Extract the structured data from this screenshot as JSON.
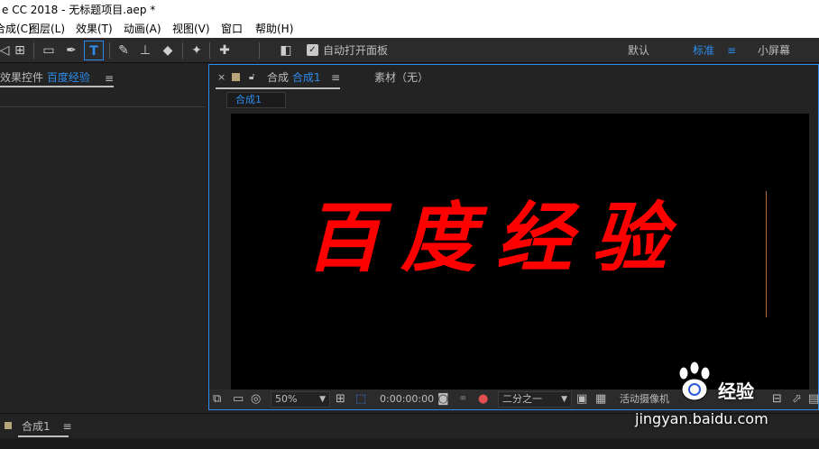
{
  "window": {
    "title": "e CC 2018 - 无标题项目.aep *"
  },
  "menu": [
    {
      "label": "合成(C)"
    },
    {
      "label": "图层(L)"
    },
    {
      "label": "效果(T)"
    },
    {
      "label": "动画(A)"
    },
    {
      "label": "视图(V)"
    },
    {
      "label": "窗口"
    },
    {
      "label": "帮助(H)"
    }
  ],
  "toolbar": {
    "auto_open_label": "自动打开面板",
    "auto_open_checked": true,
    "workspaces": [
      {
        "label": "默认",
        "active": false
      },
      {
        "label": "标准",
        "active": true
      },
      {
        "label": "小屏幕",
        "active": false
      }
    ]
  },
  "left_panel": {
    "title_prefix": "效果控件",
    "title_target": "百度经验"
  },
  "comp_panel": {
    "tab_prefix": "合成",
    "tab_name": "合成1",
    "footage_tab": "素材（无）",
    "breadcrumb": "合成1",
    "canvas_text": "百度经验",
    "text_color": "#ff0000"
  },
  "viewer_bar": {
    "zoom": "50%",
    "timecode": "0:00:00:00",
    "resolution": "二分之一",
    "renderer": "活动摄像机"
  },
  "timeline": {
    "tab_name": "合成1"
  },
  "watermark": {
    "logo_text": "经验",
    "url": "jingyan.baidu.com"
  },
  "colors": {
    "accent": "#2d8ceb",
    "panel_bg": "#232323",
    "canvas_bg": "#000000"
  }
}
